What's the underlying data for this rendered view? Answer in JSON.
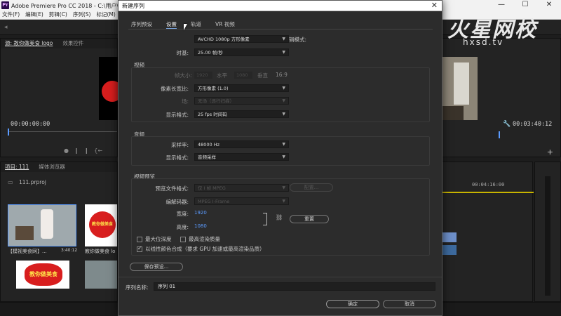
{
  "app": {
    "title": "Adobe Premiere Pro CC 2018 - C:\\用户\\hxsd",
    "logo": "Pr",
    "controls": [
      "—",
      "☐",
      "✕"
    ]
  },
  "menu": [
    "文件(F)",
    "编辑(E)",
    "剪辑(C)",
    "序列(S)",
    "标记(M)"
  ],
  "source_panel": {
    "tabs": [
      "源: 教你做美食 logo",
      "效果控件"
    ],
    "timecode": "00:00:00:00"
  },
  "program_panel": {
    "timecode": "00:03:40:12"
  },
  "project_panel": {
    "tabs": [
      "项目: 111",
      "媒体浏览器"
    ],
    "file": "111.prproj",
    "items": [
      {
        "label": "【模视美食网】...",
        "duration": "3:40:12"
      },
      {
        "label": "教你做美食 lo"
      }
    ],
    "logo_text": "教你做美食"
  },
  "timeline_panel": {
    "ruler": "00:04:16:00"
  },
  "watermark": {
    "text": "火星网校",
    "url": "hxsd.tv"
  },
  "dialog": {
    "title": "新建序列",
    "close": "✕",
    "tabs": [
      "序列预设",
      "设置",
      "轨道",
      "VR 视频"
    ],
    "active_tab": "设置",
    "edit_mode": {
      "label": "编辑模式:",
      "value": "AVCHD 1080p 方形像素"
    },
    "timebase": {
      "label": "时基:",
      "value": "25.00 帧/秒"
    },
    "video": {
      "title": "视频",
      "frame_size_label": "帧大小:",
      "horizontal_label": "水平",
      "horizontal_value": "1920",
      "vertical_label": "垂直",
      "vertical_value": "1080",
      "aspect": "16:9",
      "pixel_aspect": {
        "label": "像素长宽比:",
        "value": "方形像素 (1.0)"
      },
      "fields": {
        "label": "场:",
        "value": "无场（逐行扫描）"
      },
      "display_format": {
        "label": "显示格式:",
        "value": "25 fps 时间码"
      }
    },
    "audio": {
      "title": "音频",
      "sample_rate": {
        "label": "采样率:",
        "value": "48000 Hz"
      },
      "display_format": {
        "label": "显示格式:",
        "value": "音频采样"
      }
    },
    "preview": {
      "title": "视频预览",
      "file_format": {
        "label": "预览文件格式:",
        "value": "仅 I 帧 MPEG"
      },
      "config_button": "配置...",
      "codec": {
        "label": "编解码器:",
        "value": "MPEG I-Frame"
      },
      "width": {
        "label": "宽度:",
        "value": "1920"
      },
      "height": {
        "label": "高度:",
        "value": "1080"
      },
      "reset_button": "重置"
    },
    "checkboxes": [
      {
        "label": "最大位深度",
        "checked": false
      },
      {
        "label": "最高渲染质量",
        "checked": false
      },
      {
        "label": "以线性颜色合成（要求 GPU 加速或最高渲染品质）",
        "checked": true
      }
    ],
    "save_preset_button": "保存预设...",
    "sequence_name": {
      "label": "序列名称:",
      "value": "序列 01"
    },
    "ok_button": "确定",
    "cancel_button": "取消"
  },
  "colors": {
    "accent_blue": "#5b9bff",
    "dialog_bg": "#2c2c2c",
    "app_bg": "#1d1d1d",
    "food_red": "#d81e1e"
  }
}
